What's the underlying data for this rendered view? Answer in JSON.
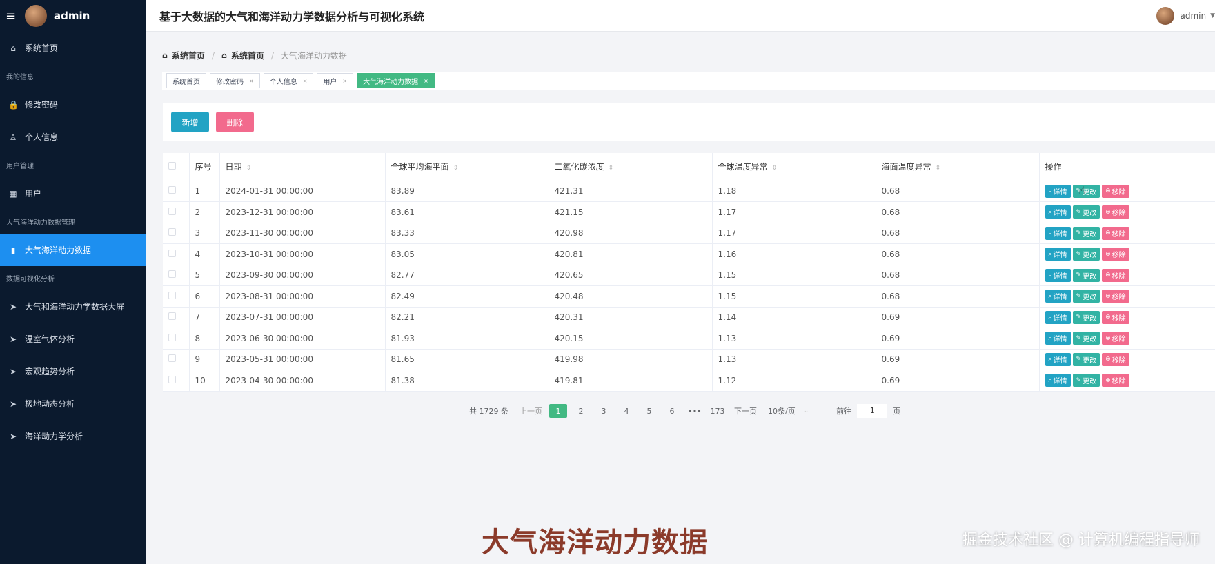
{
  "sidebar": {
    "user": "admin",
    "items": [
      {
        "type": "item",
        "label": "系统首页",
        "icon": "home-icon",
        "glyph": "⌂"
      },
      {
        "type": "group",
        "label": "我的信息"
      },
      {
        "type": "item",
        "label": "修改密码",
        "icon": "lock-icon",
        "glyph": "🔒"
      },
      {
        "type": "item",
        "label": "个人信息",
        "icon": "user-icon",
        "glyph": "♙"
      },
      {
        "type": "group",
        "label": "用户管理"
      },
      {
        "type": "item",
        "label": "用户",
        "icon": "grid-icon",
        "glyph": "▦"
      },
      {
        "type": "group",
        "label": "大气海洋动力数据管理"
      },
      {
        "type": "item",
        "label": "大气海洋动力数据",
        "icon": "bar-chart-icon",
        "glyph": "▮",
        "active": true
      },
      {
        "type": "group",
        "label": "数据可视化分析"
      },
      {
        "type": "item",
        "label": "大气和海洋动力学数据大屏",
        "icon": "send-icon",
        "glyph": "➤"
      },
      {
        "type": "item",
        "label": "温室气体分析",
        "icon": "send-icon",
        "glyph": "➤"
      },
      {
        "type": "item",
        "label": "宏观趋势分析",
        "icon": "send-icon",
        "glyph": "➤"
      },
      {
        "type": "item",
        "label": "极地动态分析",
        "icon": "send-icon",
        "glyph": "➤"
      },
      {
        "type": "item",
        "label": "海洋动力学分析",
        "icon": "send-icon",
        "glyph": "➤"
      }
    ]
  },
  "header": {
    "title": "基于大数据的大气和海洋动力学数据分析与可视化系统",
    "user": "admin"
  },
  "breadcrumb": [
    "系统首页",
    "系统首页",
    "大气海洋动力数据"
  ],
  "tags": [
    {
      "label": "系统首页",
      "closable": false
    },
    {
      "label": "修改密码",
      "closable": true
    },
    {
      "label": "个人信息",
      "closable": true
    },
    {
      "label": "用户",
      "closable": true
    },
    {
      "label": "大气海洋动力数据",
      "closable": true,
      "active": true
    }
  ],
  "actions": {
    "add": "新增",
    "delete": "删除"
  },
  "table": {
    "columns": [
      "序号",
      "日期",
      "全球平均海平面",
      "二氧化碳浓度",
      "全球温度异常",
      "海面温度异常",
      "操作"
    ],
    "sortable": [
      false,
      true,
      true,
      true,
      true,
      true,
      false
    ],
    "rows": [
      [
        "1",
        "2024-01-31 00:00:00",
        "83.89",
        "421.31",
        "1.18",
        "0.68"
      ],
      [
        "2",
        "2023-12-31 00:00:00",
        "83.61",
        "421.15",
        "1.17",
        "0.68"
      ],
      [
        "3",
        "2023-11-30 00:00:00",
        "83.33",
        "420.98",
        "1.17",
        "0.68"
      ],
      [
        "4",
        "2023-10-31 00:00:00",
        "83.05",
        "420.81",
        "1.16",
        "0.68"
      ],
      [
        "5",
        "2023-09-30 00:00:00",
        "82.77",
        "420.65",
        "1.15",
        "0.68"
      ],
      [
        "6",
        "2023-08-31 00:00:00",
        "82.49",
        "420.48",
        "1.15",
        "0.68"
      ],
      [
        "7",
        "2023-07-31 00:00:00",
        "82.21",
        "420.31",
        "1.14",
        "0.69"
      ],
      [
        "8",
        "2023-06-30 00:00:00",
        "81.93",
        "420.15",
        "1.13",
        "0.69"
      ],
      [
        "9",
        "2023-05-31 00:00:00",
        "81.65",
        "419.98",
        "1.13",
        "0.69"
      ],
      [
        "10",
        "2023-04-30 00:00:00",
        "81.38",
        "419.81",
        "1.12",
        "0.69"
      ]
    ],
    "row_ops": {
      "detail": "详情",
      "edit": "更改",
      "remove": "移除"
    }
  },
  "pagination": {
    "total": "共 1729 条",
    "prev": "上一页",
    "pages": [
      "1",
      "2",
      "3",
      "4",
      "5",
      "6",
      "•••",
      "173"
    ],
    "current": "1",
    "next": "下一页",
    "page_size": "10条/页",
    "goto_label": "前往",
    "goto_value": "1",
    "goto_suffix": "页"
  },
  "overlay": {
    "caption": "大气海洋动力数据",
    "watermark": "掘金技术社区 @ 计算机编程指导师"
  },
  "colors": {
    "sidebar_bg": "#0b1a2e",
    "sidebar_active": "#1d8ff0",
    "accent_green": "#42b983",
    "btn_add": "#22a3c4",
    "btn_delete": "#f26a8d"
  }
}
